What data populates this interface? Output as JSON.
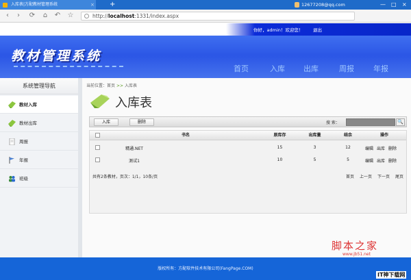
{
  "browser": {
    "tab_title": "入库表|方配教材管理系统",
    "tab_close": "×",
    "new_tab": "+",
    "user": "12677208@qq.com",
    "window_min": "—",
    "window_max": "□",
    "window_close": "×",
    "nav_back": "‹",
    "nav_forward": "›",
    "nav_reload": "⟳",
    "nav_home": "⌂",
    "nav_undo": "↶",
    "nav_star": "☆",
    "address_prefix": "http://",
    "address_host": "localhost",
    "address_rest": ":1331/index.aspx"
  },
  "header": {
    "greeting": "你好，admin！欢迎您！",
    "logout": "退出",
    "logo": "教材管理系统",
    "nav": [
      "首页",
      "入库",
      "出库",
      "周报",
      "年报"
    ]
  },
  "sidebar": {
    "title": "系统管理导航",
    "items": [
      {
        "label": "教材入库",
        "icon": "arrow-icon",
        "active": true
      },
      {
        "label": "教材出库",
        "icon": "arrow-icon",
        "active": false
      },
      {
        "label": "周报",
        "icon": "document-icon",
        "active": false
      },
      {
        "label": "年报",
        "icon": "flag-icon",
        "active": false
      },
      {
        "label": "班级",
        "icon": "people-icon",
        "active": false
      }
    ]
  },
  "content": {
    "breadcrumb_prefix": "当前位置：",
    "breadcrumb_home": "首页",
    "breadcrumb_sep": ">>",
    "breadcrumb_current": "入库表",
    "page_title": "入库表",
    "toolbar": {
      "add_label": "入库",
      "delete_label": "删除",
      "search_label": "搜  索：",
      "search_icon": "🔍"
    },
    "table": {
      "headers": [
        "书名",
        "原库存",
        "出库量",
        "结余",
        "操作"
      ],
      "rows": [
        {
          "name": "精通.NET",
          "stock": "15",
          "out": "3",
          "balance": "12",
          "actions": [
            "编辑",
            "出库",
            "删除"
          ]
        },
        {
          "name": "测试1",
          "stock": "10",
          "out": "5",
          "balance": "5",
          "actions": [
            "编辑",
            "出库",
            "删除"
          ]
        }
      ]
    },
    "pager": {
      "summary": "共有2条教材，页次：1/1，10条/页",
      "first": "首页",
      "prev": "上一页",
      "next": "下一页",
      "last": "尾页"
    }
  },
  "watermark": {
    "title": "脚本之家",
    "url": "www.jb51.net"
  },
  "footer": {
    "copyright": "版权所有：方配软件技术有限公司(FangPage.COM)"
  },
  "corner_logo": "IT神下载网"
}
